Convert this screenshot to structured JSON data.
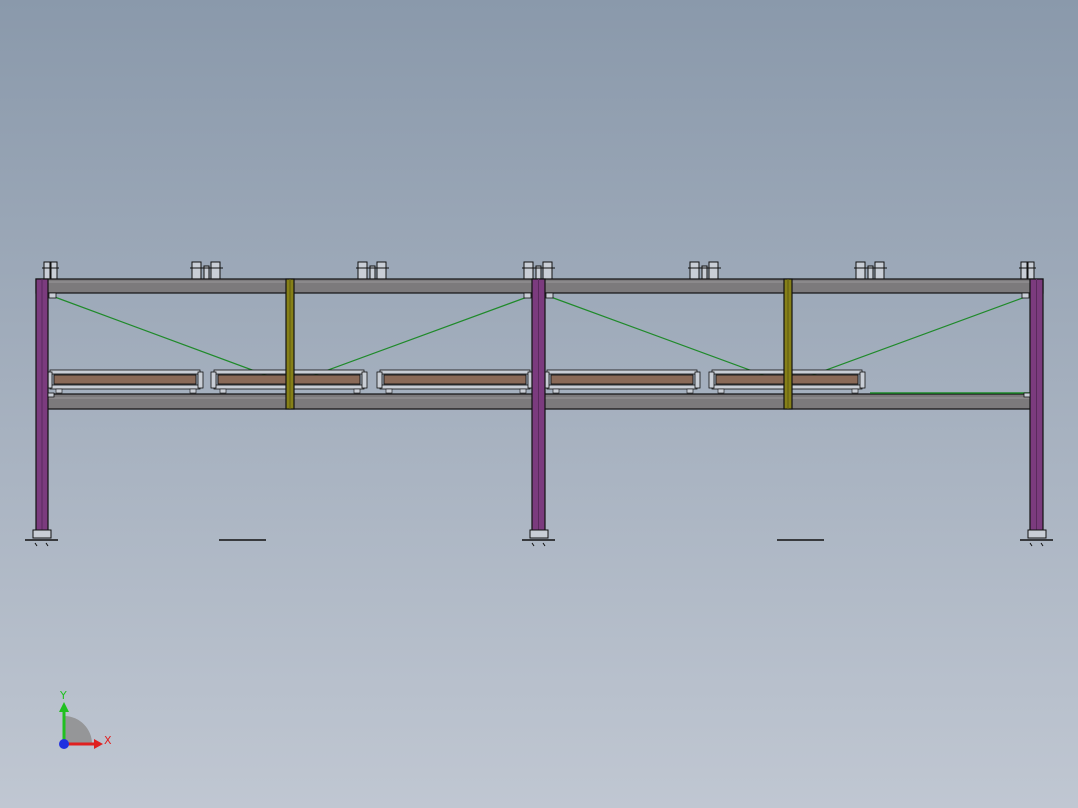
{
  "viewport": {
    "background_top": "#8a99ab",
    "background_bottom": "#c0c7d2"
  },
  "model": {
    "colors": {
      "beam": "#7c7a7c",
      "column": "#7b3b7e",
      "post": "#868018",
      "brace": "#1f8a2a",
      "tray": "#8a6a58",
      "outline": "#111111"
    }
  },
  "triad": {
    "x_label": "X",
    "y_label": "Y",
    "x_color": "#e02020",
    "y_color": "#20c020",
    "z_color": "#2030e0"
  }
}
